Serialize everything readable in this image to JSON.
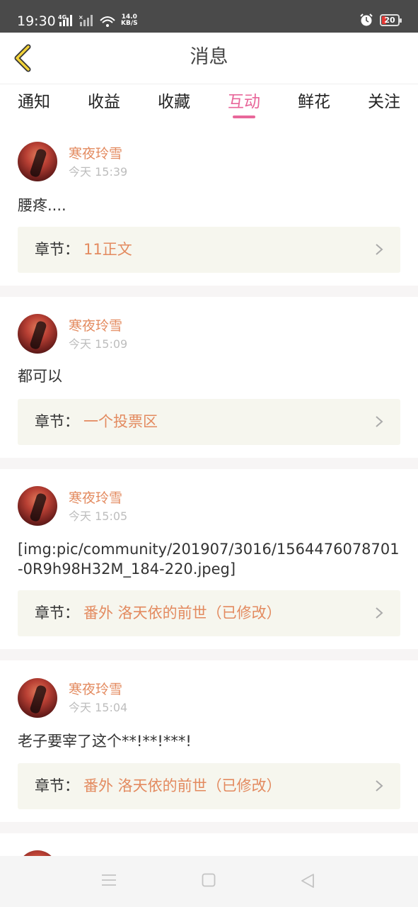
{
  "status_bar": {
    "time": "19:30",
    "network": "4G",
    "speed_value": "14.0",
    "speed_unit": "KB/S",
    "battery": "20"
  },
  "header": {
    "title": "消息"
  },
  "tabs": [
    {
      "label": "通知",
      "active": false
    },
    {
      "label": "收益",
      "active": false
    },
    {
      "label": "收藏",
      "active": false
    },
    {
      "label": "互动",
      "active": true
    },
    {
      "label": "鲜花",
      "active": false
    },
    {
      "label": "关注",
      "active": false
    }
  ],
  "chapter_prefix": "章节：",
  "messages": [
    {
      "username": "寒夜玲雪",
      "time": "今天 15:39",
      "content": "腰疼....",
      "chapter": "11正文"
    },
    {
      "username": "寒夜玲雪",
      "time": "今天 15:09",
      "content": "都可以",
      "chapter": "一个投票区"
    },
    {
      "username": "寒夜玲雪",
      "time": "今天 15:05",
      "content": "[img:pic/community/201907/3016/1564476078701-0R9h98H32M_184-220.jpeg]",
      "chapter": "番外   洛天依的前世（已修改）"
    },
    {
      "username": "寒夜玲雪",
      "time": "今天 15:04",
      "content": "老子要宰了这个**!**!***!",
      "chapter": "番外   洛天依的前世（已修改）"
    }
  ],
  "colors": {
    "accent": "#e8679a",
    "username": "#e38a5f",
    "chapter_bg": "#f6f6ee"
  },
  "nav_icons": [
    "menu-icon",
    "home-square-icon",
    "back-triangle-icon"
  ]
}
